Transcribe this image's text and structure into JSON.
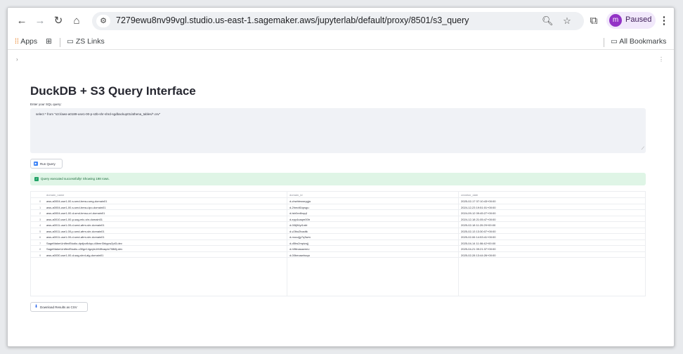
{
  "browser": {
    "url": "7279ewu8nv99vgl.studio.us-east-1.sagemaker.aws/jupyterlab/default/proxy/8501/s3_query",
    "profile_initial": "m",
    "profile_label": "Paused",
    "icons": [
      "back-icon",
      "forward-icon",
      "reload-icon",
      "home-icon",
      "site-info-icon",
      "zoom-icon",
      "star-icon",
      "extensions-icon",
      "kebab-menu-icon"
    ]
  },
  "bookmarks": {
    "apps_label": "Apps",
    "zs_links_label": "ZS Links",
    "all_bookmarks_label": "All Bookmarks"
  },
  "app": {
    "title": "DuckDB + S3 Query Interface",
    "query_label": "Enter your SQL query:",
    "query_value": "select * from \"s3://aws-a0189-use1-00-p-s3b-shr-shrd-sgdbackup01/athena_tables/*.csv\"",
    "run_button_label": "Run Query",
    "success_message": "Query executed successfully! Showing 198 rows.",
    "download_button_label": "Download Results as CSV"
  },
  "table": {
    "columns": [
      "domain_name",
      "domain_id",
      "creation_date"
    ],
    "rows": [
      {
        "index": "0",
        "domain_name": "aws-a0004-use1-00-s-smd-bmsu-smg-domain01",
        "domain_id": "d-chwhtnswrygja",
        "creation_date": "2025-02-17 07:10:43+00:00"
      },
      {
        "index": "1",
        "domain_name": "aws-a0004-use1-00-s-smd-bmsu-tpo-domain01",
        "domain_id": "d-2hmdt1kpsgu",
        "creation_date": "2024-12-23 19:51:01+00:00"
      },
      {
        "index": "2",
        "domain_name": "aws-a0004-use1-00-d-smd-bmsu-cri-domain01",
        "domain_id": "d-lsb0vv8xqqf",
        "creation_date": "2024-09-12 09:45:27+00:00"
      },
      {
        "index": "3",
        "domain_name": "aws-a0010-use1-00-p-sag-mlc-shr-domain01",
        "domain_id": "d-epy4oaqm00tr",
        "creation_date": "2024-12-18 21:05:47+00:00"
      },
      {
        "index": "4",
        "domain_name": "aws-a0011-use1-00-d-smd-afrm-shr-domain01",
        "domain_id": "d-00tj94yt1nbt",
        "creation_date": "2025-02-18 11:20:29+00:00"
      },
      {
        "index": "5",
        "domain_name": "aws-a0011-use1-00-p-smd-afrm-shr-domain01",
        "domain_id": "d-v2lbo2lvadtk",
        "creation_date": "2025-02-13 13:30:07+00:00"
      },
      {
        "index": "6",
        "domain_name": "aws-a0011-use1-00-d-smd-afrm-shr-domain01",
        "domain_id": "d-moczjjy7q3wm",
        "creation_date": "2025-02-06 14:53:41+00:00"
      },
      {
        "index": "7",
        "domain_name": "SageMakerUnifiedStudio-dpdjvz8dqo-d4bmrl3rkypw2pt3-dev",
        "domain_id": "d-d5hs2mpizojj",
        "creation_date": "2025-04-14 11:06:42+00:00"
      },
      {
        "index": "8",
        "domain_name": "SageMakerUnifiedStudio-c30ge14gzyls1f48fvaqdc708t8j-dev",
        "domain_id": "d-h9ttnasawmrv",
        "creation_date": "2025-04-21 09:21:37+00:00"
      },
      {
        "index": "9",
        "domain_name": "aws-a0030-use1-00-d-sag-shrd-alg-domain01",
        "domain_id": "d-00beoawhoqa",
        "creation_date": "2025-02-28 13:44:26+00:00"
      }
    ]
  }
}
